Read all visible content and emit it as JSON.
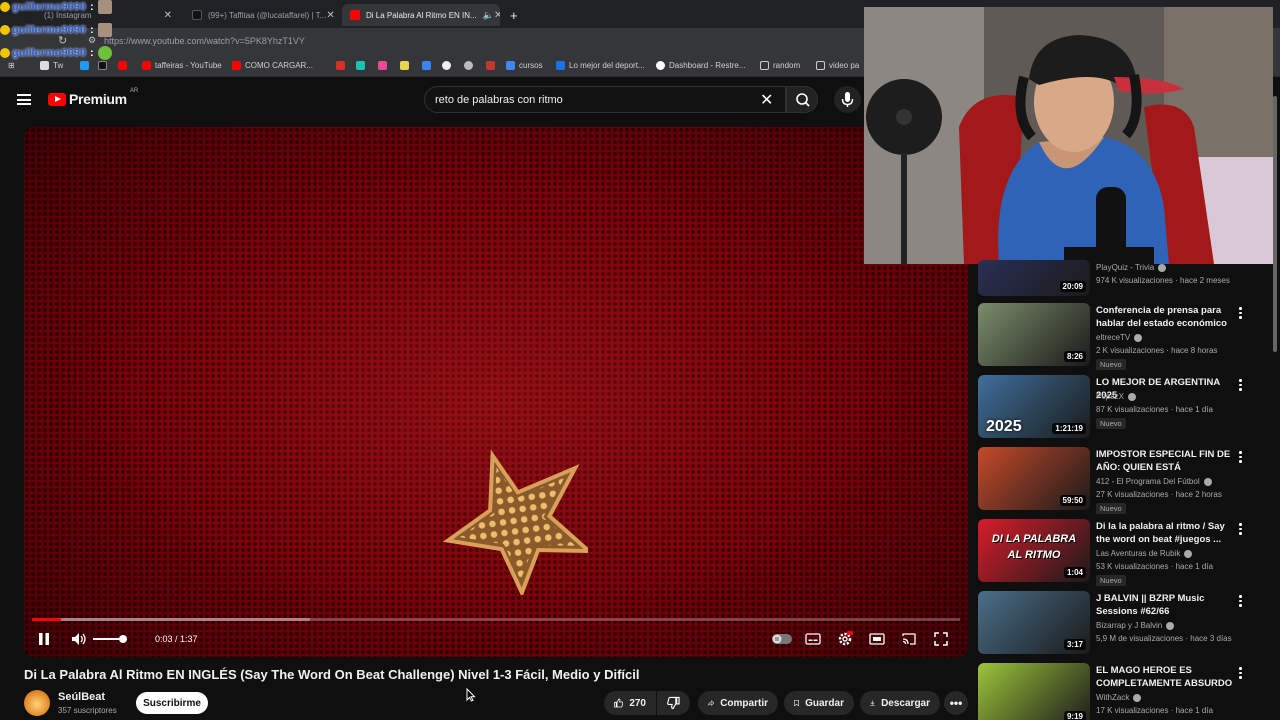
{
  "browser": {
    "tabs": [
      {
        "title": "(1) Instagram"
      },
      {
        "title": "(99+) Taffitaa (@lucataffarel) | T..."
      },
      {
        "title": "Di La Palabra Al Ritmo EN IN..."
      }
    ],
    "new_tab": "+",
    "url": "https://www.youtube.com/watch?v=5PK8YhzT1VY",
    "bookmarks": [
      "Tw",
      "taffeiras - YouTube",
      "COMO CARGAR...",
      "cursos",
      "Lo mejor del deport...",
      "Dashboard - Restre...",
      "random",
      "video pa"
    ]
  },
  "chat_overlay": [
    {
      "user": "guillermo9090",
      "sep": ":"
    },
    {
      "user": "guillermo9090",
      "sep": ":"
    },
    {
      "user": "guillermo9090",
      "sep": ":"
    }
  ],
  "masthead": {
    "brand": "Premium",
    "country": "AR",
    "search_value": "reto de palabras con ritmo"
  },
  "player": {
    "time": "0:03 / 1:37",
    "played_fraction": 0.031,
    "buffered_fraction": 0.3
  },
  "video": {
    "title": "Di La Palabra Al Ritmo EN INGLÉS (Say The Word On Beat Challenge) Nivel 1-3 Fácil, Medio y Difícil",
    "channel": "SeúlBeat",
    "subscribers": "357 suscriptores",
    "subscribe_label": "Suscribirme",
    "likes": "270",
    "share_label": "Compartir",
    "save_label": "Guardar",
    "download_label": "Descargar"
  },
  "recommendations": [
    {
      "title": "",
      "channel": "PlayQuiz - Trivia",
      "meta": "974 K visualizaciones · hace 2 meses",
      "duration": "20:09",
      "new": "",
      "thumb_color": "#2a2f55"
    },
    {
      "title": "Conferencia de prensa para hablar del estado económico y...",
      "channel": "eltreceTV",
      "meta": "2 K visualizaciones · hace 8 horas",
      "duration": "8:26",
      "new": "Nuevo",
      "thumb_color": "#7b8d6a"
    },
    {
      "title": "LO MEJOR DE ARGENTINA 2025",
      "channel": "PepazX",
      "meta": "87 K visualizaciones · hace 1 día",
      "duration": "1:21:19",
      "new": "Nuevo",
      "thumb_color": "#3f6f9c"
    },
    {
      "title": "IMPOSTOR ESPECIAL FIN DE AÑO: QUIEN ESTÁ MINTIEND...",
      "channel": "412 - El Programa Del Fútbol",
      "meta": "27 K visualizaciones · hace 2 horas",
      "duration": "59:50",
      "new": "Nuevo",
      "thumb_color": "#c44a2a"
    },
    {
      "title": "Di la la palabra al ritmo / Say the word on beat #juegos ...",
      "channel": "Las Aventuras de Rubik",
      "meta": "53 K visualizaciones · hace 1 día",
      "duration": "1:04",
      "new": "Nuevo",
      "thumb_color": "#d81c2a"
    },
    {
      "title": "J BALVIN || BZRP Music Sessions #62/66",
      "channel": "Bizarrap y J Balvin",
      "meta": "5,9 M de visualizaciones · hace 3 días",
      "duration": "3:17",
      "new": "",
      "thumb_color": "#4a6f8a"
    },
    {
      "title": "EL MAGO HEROE ES COMPLETAMENTE ABSURDO",
      "channel": "WithZack",
      "meta": "17 K visualizaciones · hace 1 día",
      "duration": "9:19",
      "new": "",
      "thumb_color": "#9cc43a"
    }
  ],
  "thumb_text": {
    "argentina": "2025",
    "palabra": "DI LA PALABRA AL RITMO"
  },
  "colors": {
    "accent": "#ff0000",
    "background": "#0f0f0f",
    "player_red": "#7a0008"
  }
}
